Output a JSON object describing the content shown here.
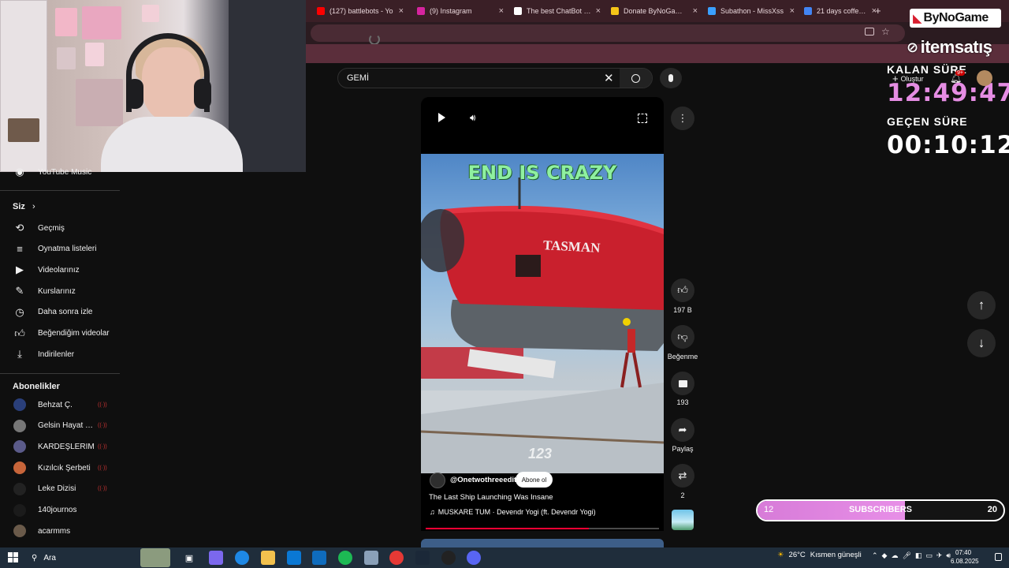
{
  "tabs": [
    {
      "title": "(127) battlebots - Yo",
      "favicon_color": "#ff0000"
    },
    {
      "title": "(9) Instagram",
      "favicon_color": "#d6249f"
    },
    {
      "title": "The best ChatBot an",
      "favicon_color": "#ffffff"
    },
    {
      "title": "Donate ByNoGame -",
      "favicon_color": "#f5c518"
    },
    {
      "title": "Subathon - MissXss",
      "favicon_color": "#3aa0ff"
    },
    {
      "title": "21 days coffee - Goo",
      "favicon_color": "#4285f4"
    }
  ],
  "search": {
    "query": "GEMİ"
  },
  "sidebar": {
    "top_item": "YouTube Music",
    "you_section": "Siz",
    "you_items": [
      "Geçmiş",
      "Oynatma listeleri",
      "Videolarınız",
      "Kurslarınız",
      "Daha sonra izle",
      "Beğendiğim videolar",
      "İndirilenler"
    ],
    "subs_section": "Abonelikler",
    "subscriptions": [
      {
        "name": "Behzat Ç.",
        "live": true,
        "color": "#2a3f7a"
      },
      {
        "name": "Gelsin Hayat Bild...",
        "live": true,
        "color": "#777777"
      },
      {
        "name": "KARDEŞLERİM",
        "live": true,
        "color": "#5b5b8a"
      },
      {
        "name": "Kızılcık Şerbeti",
        "live": true,
        "color": "#c7653a"
      },
      {
        "name": "Leke Dizisi",
        "live": true,
        "color": "#222222"
      },
      {
        "name": "140journos",
        "live": false,
        "color": "#1b1b1b"
      },
      {
        "name": "acarmms",
        "live": false,
        "color": "#6a5a4a"
      }
    ],
    "live_mark": "((·))"
  },
  "video": {
    "overlay_text": "END IS CRAZY",
    "ship_name": "TASMAN",
    "watermark": "123",
    "channel": "@Onetwothreeedit",
    "subscribe_label": "Abone ol",
    "title": "The Last Ship Launching Was Insane",
    "music": "MUSKARE TUM · Devendr Yogi (ft. Devendr Yogi)",
    "progress": 0.7
  },
  "actions": {
    "likes": "197 B",
    "dislike_label": "Beğenme",
    "comments": "193",
    "share_label": "Paylaş",
    "remix": "2"
  },
  "header_right": {
    "create_label": "Oluştur",
    "notif_badge": "9+"
  },
  "stream": {
    "remaining_label": "KALAN SÜRE",
    "remaining_value": "12:49:47",
    "elapsed_label": "GEÇEN SÜRE",
    "elapsed_value": "00:10:12",
    "sponsor_1": "ByNoGame",
    "sponsor_2": "itemsatış",
    "subs_current": "12",
    "subs_label": "SUBSCRIBERS",
    "subs_goal": "20",
    "subs_fraction": 0.6,
    "remaining_color": "#e58de3",
    "elapsed_color": "#ffffff"
  },
  "taskbar": {
    "search_placeholder": "Ara",
    "weather_temp": "26°C",
    "weather_desc": "Kısmen güneşli",
    "time": "07:40",
    "date": "6.08.2025"
  }
}
